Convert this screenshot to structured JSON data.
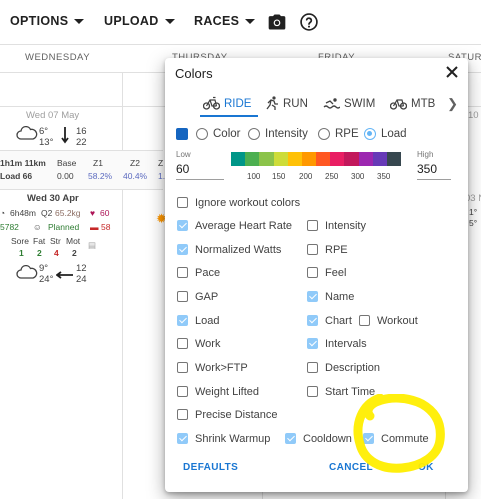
{
  "topbar": {
    "options_label": "OPTIONS",
    "upload_label": "UPLOAD",
    "races_label": "RACES",
    "camera_icon": "camera-icon",
    "help_icon": "help-circle-icon"
  },
  "calendar": {
    "days": [
      "WEDNESDAY",
      "THURSDAY",
      "FRIDAY",
      "SATURDA"
    ],
    "week1": {
      "date": "Wed 07 May",
      "temp_hi": "6°",
      "temp_lo": "13°",
      "wind1": "16",
      "wind2": "22"
    },
    "stats_header": [
      "1h1m 11km",
      "Base",
      "Z1",
      "Z2",
      "Z"
    ],
    "stats_values": [
      "Load 66",
      "0.00",
      "58.2%",
      "40.4%",
      "1."
    ],
    "week2": {
      "date": "Wed 30 Apr",
      "duration": "6h48m",
      "q": "Q2",
      "weight": "65.2kg",
      "hr": "60",
      "steps": "5782",
      "planned": "Planned",
      "other": "58",
      "wellness_labels": [
        "Sore",
        "Fat",
        "Str",
        "Mot"
      ],
      "wellness_values": [
        "1",
        "2",
        "4",
        "2"
      ],
      "temp_hi": "9°",
      "temp_lo": "24°",
      "wind1": "12",
      "wind2": "24"
    },
    "right_partial": [
      "10",
      "03 N",
      "1°",
      "5°"
    ]
  },
  "dialog": {
    "title": "Colors",
    "tabs": [
      {
        "label": "RIDE",
        "icon": "bike-icon",
        "active": true
      },
      {
        "label": "RUN",
        "icon": "run-icon",
        "active": false
      },
      {
        "label": "SWIM",
        "icon": "swim-icon",
        "active": false
      },
      {
        "label": "MTB",
        "icon": "bike-icon",
        "active": false
      }
    ],
    "color_options": {
      "swatch_color": "#1565c0",
      "radios": [
        {
          "label": "Color",
          "selected": false
        },
        {
          "label": "Intensity",
          "selected": false
        },
        {
          "label": "RPE",
          "selected": false
        },
        {
          "label": "Load",
          "selected": true
        }
      ]
    },
    "low": {
      "label": "Low",
      "value": "60"
    },
    "high": {
      "label": "High",
      "value": "350"
    },
    "scale_colors": [
      "#009688",
      "#4caf50",
      "#8bc34a",
      "#cddc39",
      "#ffc107",
      "#ff9800",
      "#ff5722",
      "#e91e63",
      "#c2185b",
      "#9c27b0",
      "#673ab7",
      "#37474f"
    ],
    "scale_ticks": [
      "100",
      "150",
      "200",
      "250",
      "300",
      "350"
    ],
    "checkboxes_left": [
      {
        "label": "Ignore workout colors",
        "checked": false
      },
      {
        "label": "Average Heart Rate",
        "checked": true
      },
      {
        "label": "Normalized Watts",
        "checked": true
      },
      {
        "label": "Pace",
        "checked": false
      },
      {
        "label": "GAP",
        "checked": false
      },
      {
        "label": "Load",
        "checked": true
      },
      {
        "label": "Work",
        "checked": false
      },
      {
        "label": "Work>FTP",
        "checked": false
      },
      {
        "label": "Weight Lifted",
        "checked": false
      },
      {
        "label": "Precise Distance",
        "checked": false
      },
      {
        "label": "Shrink Warmup",
        "checked": true
      }
    ],
    "checkboxes_right": [
      {
        "label": "Intensity",
        "checked": false
      },
      {
        "label": "RPE",
        "checked": false
      },
      {
        "label": "Feel",
        "checked": false
      },
      {
        "label": "Name",
        "checked": true
      },
      {
        "label": "Chart",
        "checked": true
      },
      {
        "label": "Intervals",
        "checked": true
      },
      {
        "label": "Description",
        "checked": false
      },
      {
        "label": "Start Time",
        "checked": false
      }
    ],
    "workout": {
      "label": "Workout",
      "checked": false
    },
    "cooldown": {
      "label": "Cooldown",
      "checked": true
    },
    "commute": {
      "label": "Commute",
      "checked": true
    },
    "defaults_label": "DEFAULTS",
    "cancel_label": "CANCEL",
    "ok_label": "OK",
    "highlight_color": "#ffee00"
  }
}
